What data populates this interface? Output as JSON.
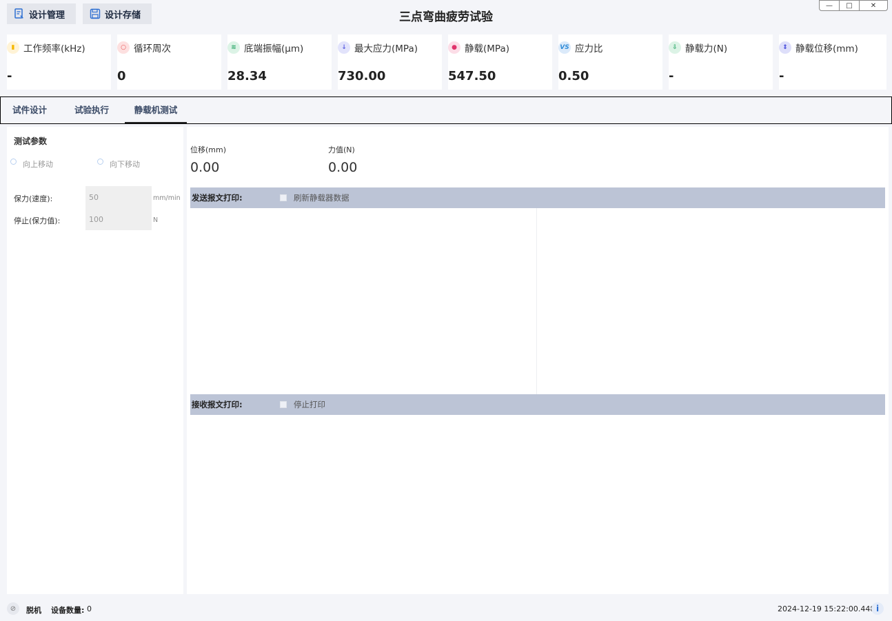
{
  "toolbar": {
    "design_manage_label": "设计管理",
    "design_store_label": "设计存储"
  },
  "window": {
    "title": "三点弯曲疲劳试验",
    "minimize": "—",
    "restore": "□",
    "close": "✕"
  },
  "stats": [
    {
      "label": "工作频率(kHz)",
      "value": "-",
      "icon": "bar-chart-icon",
      "color": "#f5b800"
    },
    {
      "label": "循环周次",
      "value": "0",
      "icon": "ring-icon",
      "color": "#e84e4e"
    },
    {
      "label": "底端振幅(μm)",
      "value": "28.34",
      "icon": "wave-icon",
      "color": "#2ea86a"
    },
    {
      "label": "最大应力(MPa)",
      "value": "730.00",
      "icon": "arrow-down-icon",
      "color": "#5b5fe0"
    },
    {
      "label": "静载(MPa)",
      "value": "547.50",
      "icon": "weight-icon",
      "color": "#e0336b"
    },
    {
      "label": "应力比",
      "value": "0.50",
      "icon": "vs-icon",
      "color": "#2d8bd8"
    },
    {
      "label": "静载力(N)",
      "value": "-",
      "icon": "download-icon",
      "color": "#2ea86a"
    },
    {
      "label": "静载位移(mm)",
      "value": "-",
      "icon": "displacement-icon",
      "color": "#3b3fd8"
    }
  ],
  "tabs": [
    {
      "label": "试件设计"
    },
    {
      "label": "试验执行"
    },
    {
      "label": "静载机测试"
    }
  ],
  "left_panel": {
    "title": "测试参数",
    "radio_up": "向上移动",
    "radio_down": "向下移动",
    "hold_speed_label": "保力(速度):",
    "hold_speed_value": "50",
    "hold_speed_unit": "mm/min",
    "stop_label": "停止(保力值):",
    "stop_value": "100",
    "stop_unit": "N"
  },
  "right_panel": {
    "displacement_label": "位移(mm)",
    "displacement_value": "0.00",
    "force_label": "力值(N)",
    "force_value": "0.00",
    "send_label": "发送报文打印:",
    "refresh_label": "刷新静载器数据",
    "recv_label": "接收报文打印:",
    "stop_print_label": "停止打印"
  },
  "statusbar": {
    "connection": "脱机",
    "device_count_label": "设备数量:",
    "device_count": "0",
    "timestamp": "2024-12-19 15:22:00.448",
    "info_icon": "i"
  }
}
